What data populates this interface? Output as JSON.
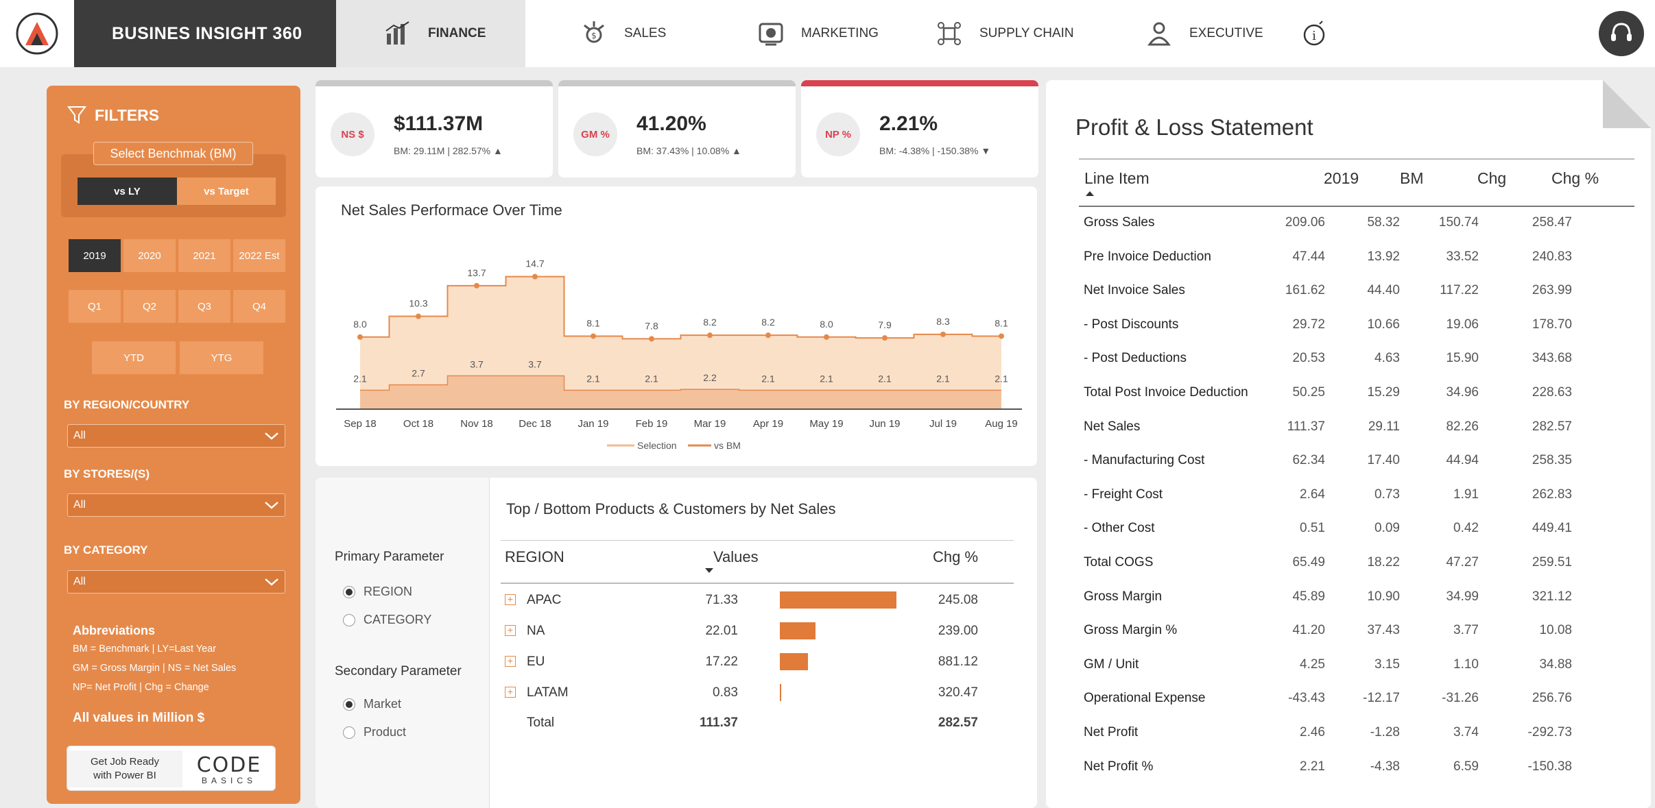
{
  "brand": {
    "title": "BUSINES INSIGHT 360"
  },
  "nav": {
    "tabs": [
      {
        "label": "FINANCE",
        "icon": "finance-icon",
        "active": true
      },
      {
        "label": "SALES",
        "icon": "sales-icon",
        "active": false
      },
      {
        "label": "MARKETING",
        "icon": "marketing-icon",
        "active": false
      },
      {
        "label": "SUPPLY CHAIN",
        "icon": "supply-chain-icon",
        "active": false
      },
      {
        "label": "EXECUTIVE",
        "icon": "executive-icon",
        "active": false
      }
    ],
    "info_icon": "info-icon",
    "support_icon": "headset-icon"
  },
  "filters": {
    "title": "FILTERS",
    "benchmark_label": "Select Benchmak (BM)",
    "benchmark_options": [
      "vs LY",
      "vs Target"
    ],
    "years": [
      "2019",
      "2020",
      "2021",
      "2022 Est"
    ],
    "quarters": [
      "Q1",
      "Q2",
      "Q3",
      "Q4"
    ],
    "periods": [
      "YTD",
      "YTG"
    ],
    "region_label": "BY REGION/COUNTRY",
    "region_value": "All",
    "stores_label": "BY STORES/(S)",
    "stores_value": "All",
    "category_label": "BY CATEGORY",
    "category_value": "All",
    "abbr_title": "Abbreviations",
    "abbr_lines": [
      "BM = Benchmark | LY=Last Year",
      "GM = Gross Margin | NS = Net Sales",
      "NP= Net Profit | Chg = Change"
    ],
    "all_values": "All values in Million $",
    "banner_left_1": "Get Job Ready",
    "banner_left_2": "with Power BI",
    "banner_code": "CODE",
    "banner_basics": "BASICS"
  },
  "kpis": [
    {
      "badge": "NS $",
      "value": "$111.37M",
      "sub": "BM: 29.11M | 282.57% ▲"
    },
    {
      "badge": "GM %",
      "value": "41.20%",
      "sub": "BM: 37.43% | 10.08% ▲"
    },
    {
      "badge": "NP %",
      "value": "2.21%",
      "sub": "BM: -4.38% | -150.38% ▼"
    }
  ],
  "chart_data": {
    "type": "area",
    "title": "Net Sales Performace Over Time",
    "categories": [
      "Sep 18",
      "Oct 18",
      "Nov 18",
      "Dec 18",
      "Jan 19",
      "Feb 19",
      "Mar 19",
      "Apr 19",
      "May 19",
      "Jun 19",
      "Jul 19",
      "Aug 19"
    ],
    "series": [
      {
        "name": "Selection",
        "values": [
          8.0,
          10.3,
          13.7,
          14.7,
          8.1,
          7.8,
          8.2,
          8.2,
          8.0,
          7.9,
          8.3,
          8.1
        ]
      },
      {
        "name": "vs BM",
        "values": [
          2.1,
          2.7,
          3.7,
          3.7,
          2.1,
          2.1,
          2.2,
          2.1,
          2.1,
          2.1,
          2.1,
          2.1
        ]
      }
    ],
    "colors": {
      "selection_fill": "#fbe0c8",
      "bm_fill": "#f3c29c",
      "line": "#e5894a"
    },
    "legend": "bottom-center",
    "grid": false
  },
  "topbottom": {
    "title": "Top / Bottom Products & Customers by Net Sales",
    "primary_label": "Primary Parameter",
    "primary_options": [
      "REGION",
      "CATEGORY"
    ],
    "secondary_label": "Secondary Parameter",
    "secondary_options": [
      "Market",
      "Product"
    ],
    "headers": [
      "REGION",
      "Values",
      "Chg %"
    ],
    "rows": [
      {
        "name": "APAC",
        "value": "71.33",
        "num": 71.33,
        "chg": "245.08"
      },
      {
        "name": "NA",
        "value": "22.01",
        "num": 22.01,
        "chg": "239.00"
      },
      {
        "name": "EU",
        "value": "17.22",
        "num": 17.22,
        "chg": "881.12"
      },
      {
        "name": "LATAM",
        "value": "0.83",
        "num": 0.83,
        "chg": "320.47"
      }
    ],
    "total": {
      "name": "Total",
      "value": "111.37",
      "chg": "282.57"
    }
  },
  "pl": {
    "title": "Profit & Loss Statement",
    "headers": [
      "Line Item",
      "2019",
      "BM",
      "Chg",
      "Chg %"
    ],
    "rows": [
      [
        "Gross Sales",
        "209.06",
        "58.32",
        "150.74",
        "258.47"
      ],
      [
        "Pre Invoice Deduction",
        "47.44",
        "13.92",
        "33.52",
        "240.83"
      ],
      [
        "Net Invoice Sales",
        "161.62",
        "44.40",
        "117.22",
        "263.99"
      ],
      [
        "- Post Discounts",
        "29.72",
        "10.66",
        "19.06",
        "178.70"
      ],
      [
        "- Post Deductions",
        "20.53",
        "4.63",
        "15.90",
        "343.68"
      ],
      [
        "Total Post Invoice Deduction",
        "50.25",
        "15.29",
        "34.96",
        "228.63"
      ],
      [
        "Net Sales",
        "111.37",
        "29.11",
        "82.26",
        "282.57"
      ],
      [
        "- Manufacturing Cost",
        "62.34",
        "17.40",
        "44.94",
        "258.35"
      ],
      [
        "- Freight Cost",
        "2.64",
        "0.73",
        "1.91",
        "262.83"
      ],
      [
        "- Other Cost",
        "0.51",
        "0.09",
        "0.42",
        "449.41"
      ],
      [
        "Total COGS",
        "65.49",
        "18.22",
        "47.27",
        "259.51"
      ],
      [
        "Gross Margin",
        "45.89",
        "10.90",
        "34.99",
        "321.12"
      ],
      [
        "Gross Margin %",
        "41.20",
        "37.43",
        "3.77",
        "10.08"
      ],
      [
        "GM / Unit",
        "4.25",
        "3.15",
        "1.10",
        "34.88"
      ],
      [
        "Operational Expense",
        "-43.43",
        "-12.17",
        "-31.26",
        "256.76"
      ],
      [
        "Net Profit",
        "2.46",
        "-1.28",
        "3.74",
        "-292.73"
      ],
      [
        "Net Profit %",
        "2.21",
        "-4.38",
        "6.59",
        "-150.38"
      ]
    ]
  }
}
